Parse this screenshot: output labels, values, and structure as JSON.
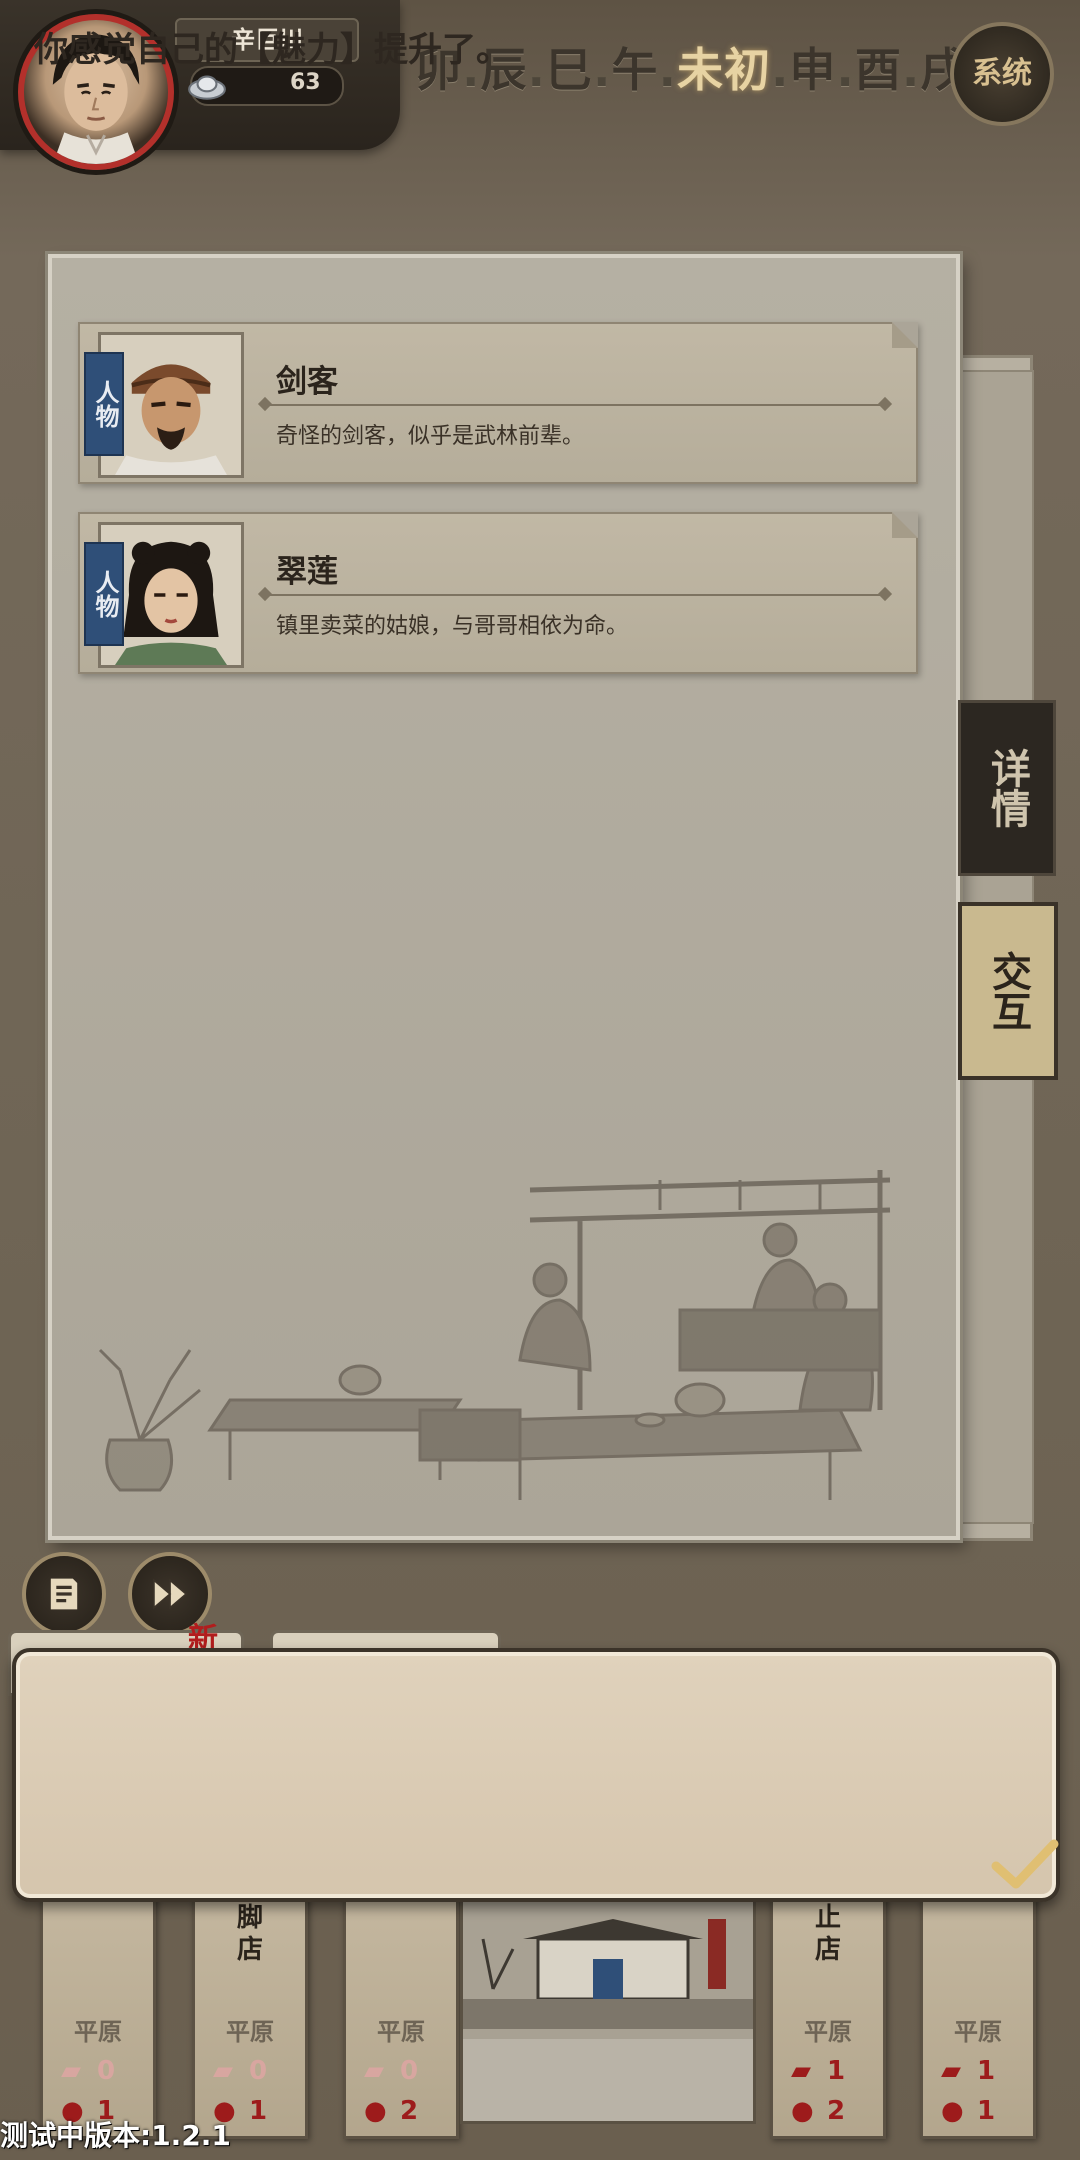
{
  "player": {
    "name": "辛巨川",
    "silver": "63"
  },
  "time_periods": [
    {
      "label": "卯",
      "active": false
    },
    {
      "label": "辰",
      "active": false
    },
    {
      "label": "巳",
      "active": false
    },
    {
      "label": "午",
      "active": false
    },
    {
      "label": "未初",
      "active": true
    },
    {
      "label": "申",
      "active": false
    },
    {
      "label": "酉",
      "active": false
    },
    {
      "label": "戌",
      "active": false
    }
  ],
  "system_button": "系统",
  "characters": [
    {
      "tag": "人物",
      "name": "剑客",
      "desc": "奇怪的剑客，似乎是武林前辈。"
    },
    {
      "tag": "人物",
      "name": "翠莲",
      "desc": "镇里卖菜的姑娘，与哥哥相依为命。"
    }
  ],
  "side_tabs": {
    "details": "详情",
    "interact": "交互"
  },
  "new_badge": "新",
  "dialog": {
    "message": "你感觉自己的【魅力】提升了。"
  },
  "locations": [
    {
      "name": "",
      "terrain": "平原",
      "events": "0",
      "people": "1"
    },
    {
      "name": "脚\n店",
      "terrain": "平原",
      "events": "0",
      "people": "1"
    },
    {
      "name": "",
      "terrain": "平原",
      "events": "0",
      "people": "2"
    },
    {
      "name": "止\n店",
      "terrain": "平原",
      "events": "1",
      "people": "2"
    },
    {
      "name": "",
      "terrain": "平原",
      "events": "1",
      "people": "1"
    }
  ],
  "version_text": "测试中版本:1.2.1",
  "colors": {
    "active_time": "#e7d3a3",
    "character_tag": "#2f4f78",
    "alert_red": "#9d1b1b"
  }
}
